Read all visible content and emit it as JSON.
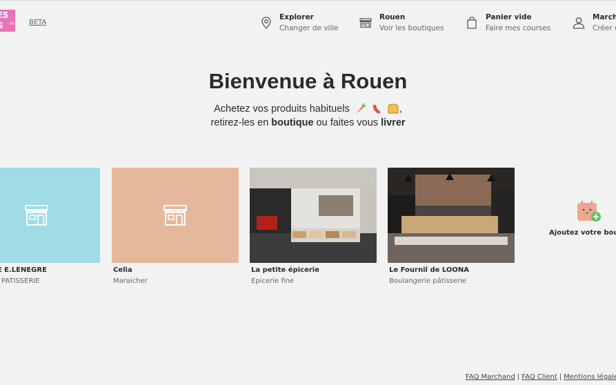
{
  "brand": {
    "logo_line1": "ES",
    "logo_line2": "S",
    "logo_fr": "FR",
    "beta": "BETA",
    "logo_color": "#e873b5"
  },
  "nav": [
    {
      "icon": "location-pin-icon",
      "title": "Explorer",
      "subtitle": "Changer de ville"
    },
    {
      "icon": "storefront-icon",
      "title": "Rouen",
      "subtitle": "Voir les boutiques"
    },
    {
      "icon": "shopping-bag-icon",
      "title": "Panier vide",
      "subtitle": "Faire mes courses"
    },
    {
      "icon": "user-icon",
      "title": "Marcha",
      "subtitle": "Créer u"
    }
  ],
  "hero": {
    "title": "Bienvenue à Rouen",
    "line1": "Achetez vos produits habituels",
    "line2_a": "retirez-les en",
    "line2_b": "boutique",
    "line2_c": "ou faites vous",
    "line2_d": "livrer",
    "comma": ","
  },
  "shops": [
    {
      "name": "NGERIE E.LENEGRE",
      "category": "NGERIE PATISSERIE",
      "bg": "#a0dbe6",
      "image": "store-icon"
    },
    {
      "name": "Celia",
      "category": "Maraicher",
      "bg": "#e6b89b",
      "image": "store-icon"
    },
    {
      "name": "La petite épicerie",
      "category": "Epicerie fine",
      "bg": "#3a3a3a",
      "image": "photo"
    },
    {
      "name": "Le Fournil de LOONA",
      "category": "Boulangerie pâtisserie",
      "bg": "#3a3a3a",
      "image": "photo"
    }
  ],
  "add_shop": {
    "label": "Ajoutez votre bouti",
    "icon": "bag-plus-icon"
  },
  "footer": {
    "faq_merchant": "FAQ Marchand",
    "faq_client": "FAQ Client",
    "legal": "Mentions légale",
    "sep": "|"
  }
}
